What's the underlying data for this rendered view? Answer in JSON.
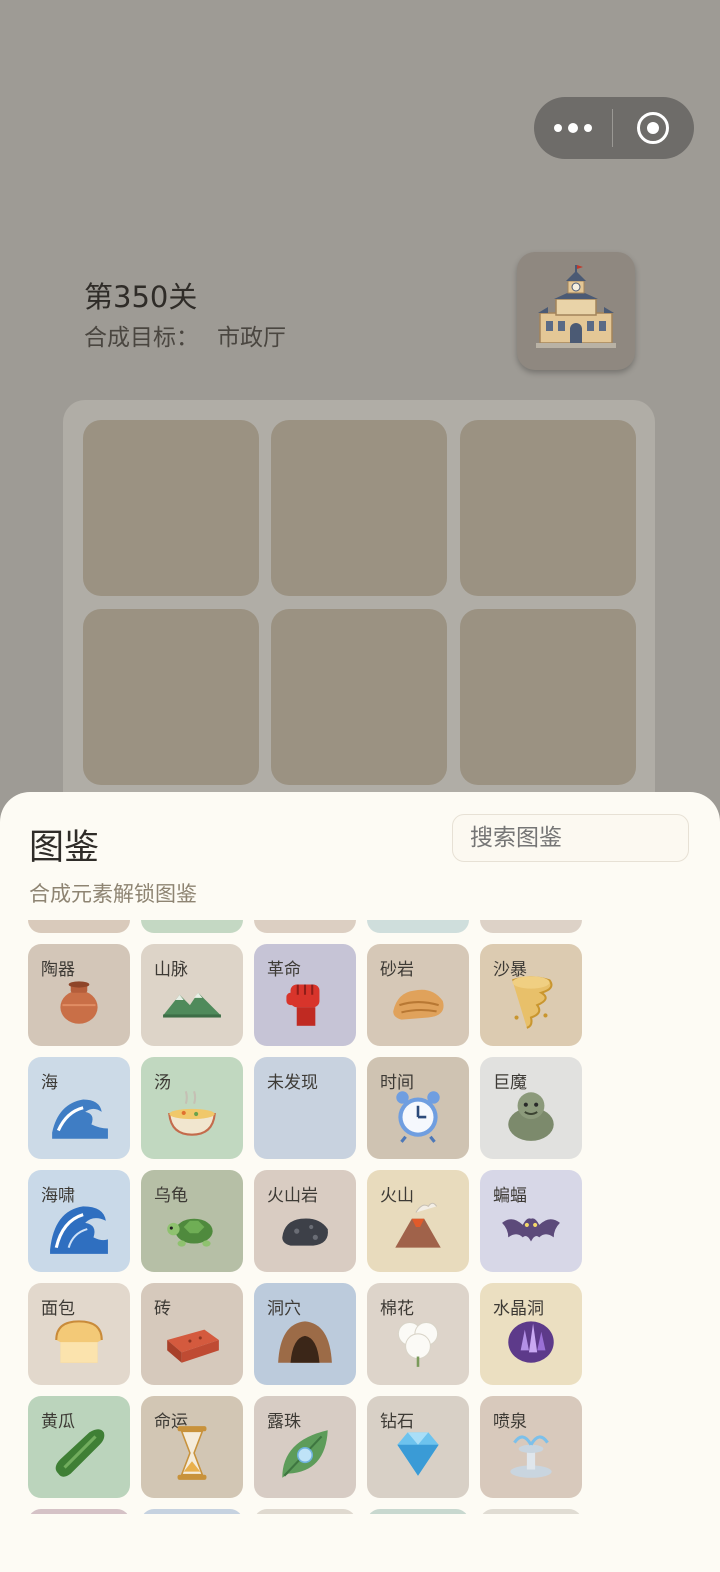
{
  "level": {
    "title": "第350关",
    "goal_label": "合成目标：",
    "goal_name": "市政厅"
  },
  "sheet": {
    "title": "图鉴",
    "search_placeholder": "搜索图鉴",
    "subtitle": "合成元素解锁图鉴"
  },
  "colors": {
    "sheet_bg": "#fdfbf4",
    "overlay": "#9e9b95"
  },
  "items": [
    {
      "label": "",
      "bg": "#d9cabb",
      "icon": "partial-row-item"
    },
    {
      "label": "",
      "bg": "#c4d8c3",
      "icon": "partial-row-item"
    },
    {
      "label": "",
      "bg": "#dccfc2",
      "icon": "partial-row-item"
    },
    {
      "label": "",
      "bg": "#cfdedc",
      "icon": "partial-row-item"
    },
    {
      "label": "",
      "bg": "#ddd2c7",
      "icon": "partial-row-item"
    },
    {
      "label": "陶器",
      "bg": "#d3c6b8",
      "icon": "clay-pot-icon"
    },
    {
      "label": "山脉",
      "bg": "#ddd4c8",
      "icon": "mountain-range-icon"
    },
    {
      "label": "革命",
      "bg": "#c6c4d6",
      "icon": "raised-fist-icon"
    },
    {
      "label": "砂岩",
      "bg": "#d6c8b7",
      "icon": "sandstone-icon"
    },
    {
      "label": "沙暴",
      "bg": "#dccbb1",
      "icon": "sandstorm-icon"
    },
    {
      "label": "海",
      "bg": "#ccdae7",
      "icon": "wave-icon"
    },
    {
      "label": "汤",
      "bg": "#c1d8c0",
      "icon": "soup-bowl-icon"
    },
    {
      "label": "未发现",
      "bg": "#c8d2df",
      "icon": ""
    },
    {
      "label": "时间",
      "bg": "#cfc3b2",
      "icon": "alarm-clock-icon"
    },
    {
      "label": "巨魔",
      "bg": "#e1e1df",
      "icon": "troll-icon"
    },
    {
      "label": "海啸",
      "bg": "#c9d9e8",
      "icon": "tsunami-icon"
    },
    {
      "label": "乌龟",
      "bg": "#b6bfa6",
      "icon": "turtle-icon"
    },
    {
      "label": "火山岩",
      "bg": "#d9ccc2",
      "icon": "volcanic-rock-icon"
    },
    {
      "label": "火山",
      "bg": "#e8dbbd",
      "icon": "volcano-icon"
    },
    {
      "label": "蝙蝠",
      "bg": "#d7d7e7",
      "icon": "bat-icon"
    },
    {
      "label": "面包",
      "bg": "#e2d8cc",
      "icon": "bread-icon"
    },
    {
      "label": "砖",
      "bg": "#d6c9bc",
      "icon": "brick-icon"
    },
    {
      "label": "洞穴",
      "bg": "#bccbdc",
      "icon": "cave-icon"
    },
    {
      "label": "棉花",
      "bg": "#ddd4ca",
      "icon": "cotton-icon"
    },
    {
      "label": "水晶洞",
      "bg": "#ebdfc1",
      "icon": "crystal-geode-icon"
    },
    {
      "label": "黄瓜",
      "bg": "#bbd4bc",
      "icon": "cucumber-icon"
    },
    {
      "label": "命运",
      "bg": "#d2c6b4",
      "icon": "hourglass-icon"
    },
    {
      "label": "露珠",
      "bg": "#d7ccc4",
      "icon": "dewdrop-leaf-icon"
    },
    {
      "label": "钻石",
      "bg": "#d8d0c6",
      "icon": "diamond-icon"
    },
    {
      "label": "喷泉",
      "bg": "#d8c9bc",
      "icon": "fountain-icon"
    },
    {
      "label": "",
      "bg": "#d5c2c6",
      "icon": "partial-row-item"
    },
    {
      "label": "",
      "bg": "#c6d2e0",
      "icon": "partial-row-item"
    },
    {
      "label": "",
      "bg": "#dfd9cf",
      "icon": "partial-row-item"
    },
    {
      "label": "",
      "bg": "#c8d8cf",
      "icon": "partial-row-item"
    },
    {
      "label": "",
      "bg": "#e0dcd3",
      "icon": "partial-row-item"
    }
  ]
}
